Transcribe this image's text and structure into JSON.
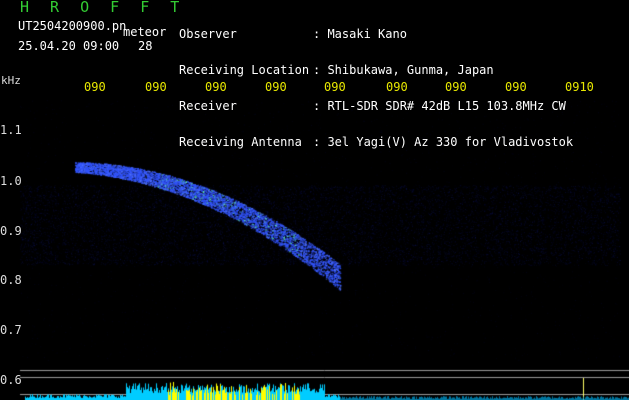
{
  "header": {
    "title": "H R O F F T",
    "filename": "UT2504200900.pn",
    "datetime": "25.04.20 09:00",
    "meteor_label": "meteor",
    "meteor_count": "28"
  },
  "info": [
    {
      "label": "Observer",
      "value": ": Masaki Kano"
    },
    {
      "label": "Receiving Location",
      "value": ": Shibukawa, Gunma, Japan"
    },
    {
      "label": "Receiver",
      "value": ": RTL-SDR SDR# 42dB L15 103.8MHz CW"
    },
    {
      "label": "Receiving Antenna",
      "value": ": 3el Yagi(V) Az 330 for Vladivostok"
    }
  ],
  "time_axis": {
    "ticks": [
      "090",
      "090",
      "090",
      "090",
      "090",
      "090",
      "090",
      "090",
      "0910"
    ]
  },
  "freq_axis": {
    "unit": "kHz",
    "ticks": [
      "1.1",
      "1.0",
      "0.9",
      "0.8",
      "0.7",
      "0.6"
    ]
  },
  "colors": {
    "title": "#33cc33",
    "ticks": "#e8e800",
    "echo": "#3355ff",
    "echo_bright": "#66ffaa",
    "spectrum": "#00ccff",
    "spectrum_peak": "#ffff00"
  }
}
